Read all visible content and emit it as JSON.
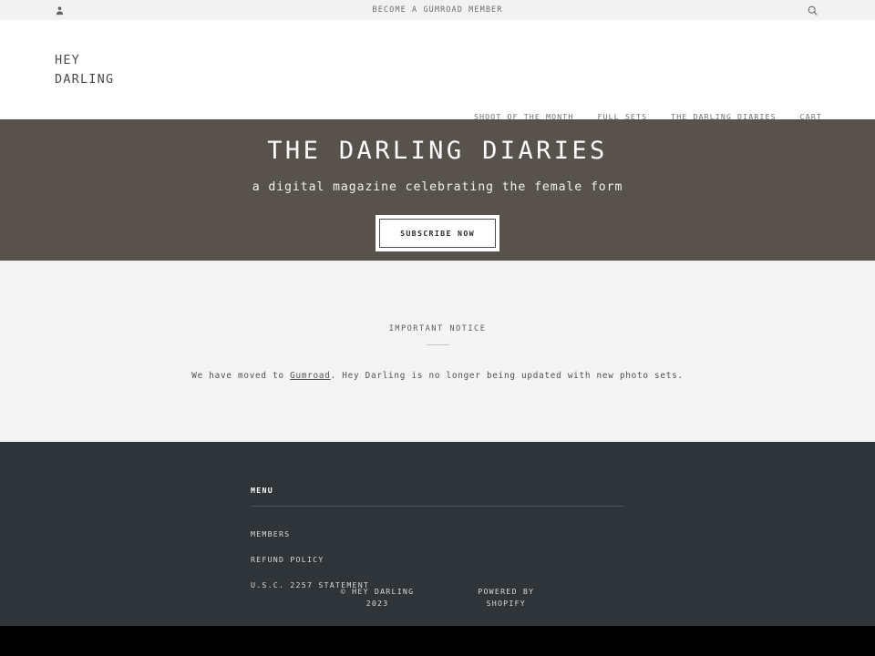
{
  "announcement": {
    "text": "BECOME A GUMROAD MEMBER",
    "account_icon": "person-icon",
    "search_icon": "search-icon"
  },
  "header": {
    "logo_line1": "HEY",
    "logo_line2": "DARLING",
    "nav": [
      {
        "label": "SHOOT OF THE MONTH"
      },
      {
        "label": "FULL SETS"
      },
      {
        "label": "THE DARLING DIARIES"
      },
      {
        "label": "CART"
      }
    ]
  },
  "hero": {
    "title": "THE DARLING DIARIES",
    "subtitle": "a digital magazine celebrating the female form",
    "button_label": "SUBSCRIBE NOW",
    "background_color": "#57524c"
  },
  "notice": {
    "title": "IMPORTANT NOTICE",
    "body_before": "We have moved to ",
    "link": "Gumroad",
    "body_after": ". Hey Darling is no longer being updated with new photo sets.",
    "background_color": "#f4f4f4"
  },
  "footer": {
    "heading": "MENU",
    "links": [
      {
        "label": "MEMBERS"
      },
      {
        "label": "REFUND POLICY"
      },
      {
        "label": "U.S.C. 2257 STATEMENT"
      }
    ],
    "copyright_line1": "© HEY DARLING",
    "copyright_line2": "2023",
    "powered_line1": "POWERED BY",
    "powered_line2": "SHOPIFY",
    "background_color": "#2f3438"
  }
}
